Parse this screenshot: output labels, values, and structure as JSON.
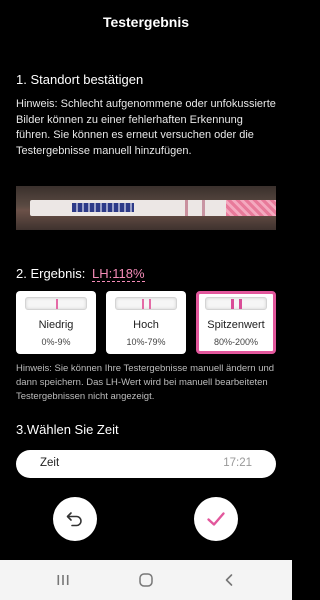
{
  "header": {
    "title": "Testergebnis"
  },
  "section1": {
    "title": "1. Standort bestätigen",
    "hint": "Hinweis: Schlecht aufgenommene oder unfokussierte Bilder können zu einer fehlerhaften Erkennung führen. Sie können es erneut versuchen oder die Testergebnisse manuell hinzufügen."
  },
  "section2": {
    "title": "2. Ergebnis:",
    "lh_value": "LH:118%",
    "cards": [
      {
        "label": "Niedrig",
        "range": "0%-9%",
        "selected": false
      },
      {
        "label": "Hoch",
        "range": "10%-79%",
        "selected": false
      },
      {
        "label": "Spitzenwert",
        "range": "80%-200%",
        "selected": true
      }
    ],
    "hint": "Hinweis: Sie können Ihre Testergebnisse manuell ändern und dann speichern. Das LH-Wert wird bei manuell bearbeiteten Testergebnissen nicht angezeigt."
  },
  "section3": {
    "title": "3.Wählen Sie Zeit",
    "time_label": "Zeit",
    "time_value": "17:21"
  },
  "actions": {
    "undo_icon": "undo-arrow-icon",
    "confirm_icon": "checkmark-icon"
  },
  "colors": {
    "accent": "#e2579c",
    "background": "#000000"
  }
}
